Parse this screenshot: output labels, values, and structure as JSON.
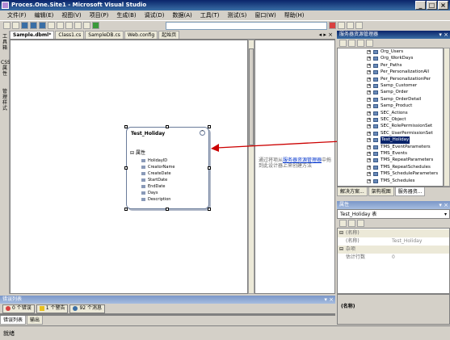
{
  "window": {
    "title": "Proces.One.Site1 - Microsoft Visual Studio",
    "controls": [
      "_",
      "□",
      "×"
    ]
  },
  "menu": [
    "文件(F)",
    "编辑(E)",
    "视图(V)",
    "项目(P)",
    "生成(B)",
    "调试(D)",
    "数据(A)",
    "工具(T)",
    "测试(S)",
    "窗口(W)",
    "帮助(H)"
  ],
  "doc_tabs": {
    "tabs": [
      "Sample.dbml*",
      "Class1.cs",
      "SampleDB.cs",
      "Web.config",
      "起始页"
    ],
    "active_index": 0,
    "controls": "◂ ▸ ×"
  },
  "left_strip": {
    "items": [
      "工具箱",
      "CSS属性",
      "管理样式"
    ]
  },
  "entity": {
    "name": "Test_Holiday",
    "section": "属性",
    "fields": [
      "HolidayID",
      "CreatorName",
      "CreateDate",
      "StartDate",
      "EndDate",
      "Days",
      "Description"
    ]
  },
  "designer_hint": {
    "before": "通过将项从",
    "link": "服务器资源管理器",
    "after": "中拖到此设计器上来创建方法"
  },
  "server_explorer": {
    "title": "服务器资源管理器",
    "controls": "▾ ×",
    "items": [
      "Org_Users",
      "Org_WorkDays",
      "Per_Paths",
      "Per_PersonalizationAll",
      "Per_PersonalizationPer",
      "Samp_Customer",
      "Samp_Order",
      "Samp_OrderDetail",
      "Samp_Product",
      "SEC_Actions",
      "SEC_Object",
      "SEC_RolePermissionSet",
      "SEC_UserPermissionSet",
      "Test_Holiday",
      "TMS_EventParameters",
      "TMS_Events",
      "TMS_RepeatParameters",
      "TMS_RepeatSchedules",
      "TMS_ScheduleParameters",
      "TMS_Schedules"
    ],
    "selected_index": 13
  },
  "right_tabs": [
    "解决方案...",
    "架构视图",
    "服务器资..."
  ],
  "properties": {
    "title": "属性",
    "controls": "▾ ×",
    "object_label": "Test_Holiday 表",
    "rows": [
      {
        "type": "category",
        "name": "(名称)"
      },
      {
        "type": "prop",
        "name": "(名称)",
        "value": "Test_Holiday"
      },
      {
        "type": "category",
        "name": "杂项"
      },
      {
        "type": "prop",
        "name": "估计行数",
        "value": "0"
      }
    ],
    "description_title": "(名称)"
  },
  "error_list": {
    "title": "错误列表",
    "controls": "▾ ×",
    "buttons": [
      "0 个错误",
      "1 个警告",
      "92 个消息"
    ],
    "tabs": [
      "错误列表",
      "输出"
    ]
  },
  "status": "就绪",
  "colors": {
    "title_bar": "#0a246a",
    "selection": "#0a246a",
    "arrow": "#cc0000",
    "link": "#0033cc"
  }
}
